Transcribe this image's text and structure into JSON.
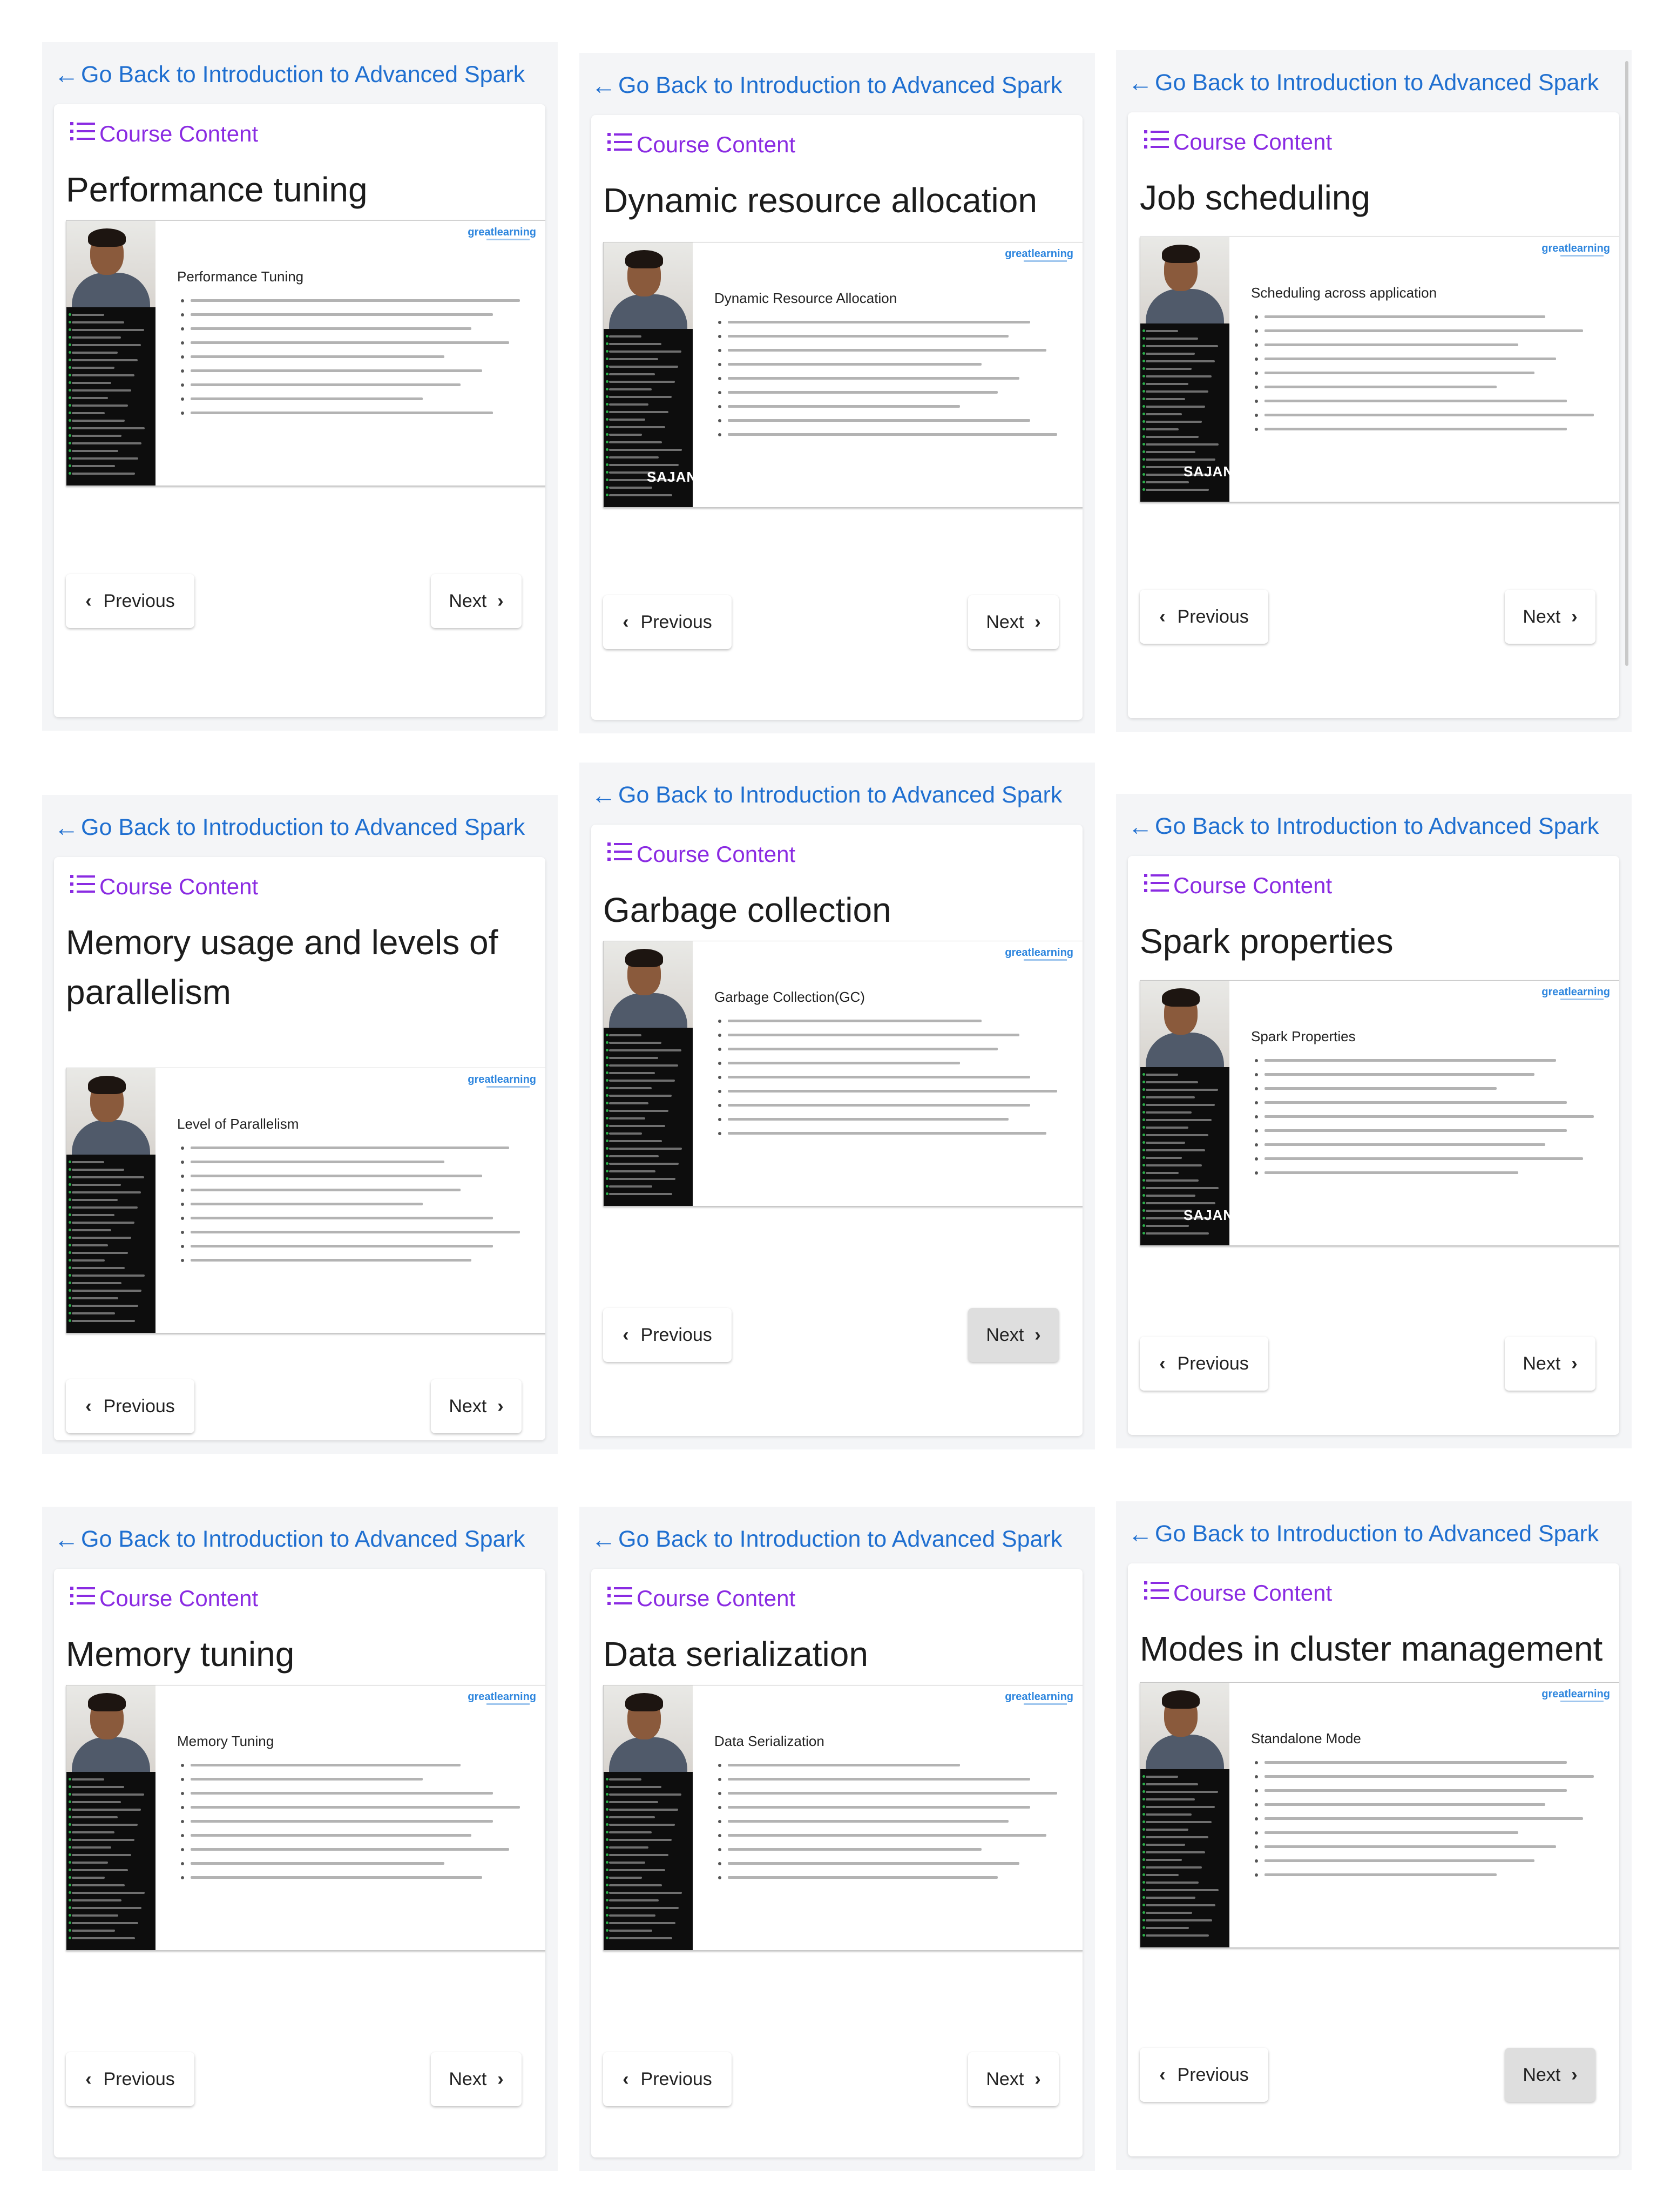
{
  "back_label": "Go Back to Introduction to Advanced Spark",
  "course_content_label": "Course Content",
  "previous_label": "Previous",
  "next_label": "Next",
  "panels": [
    {
      "title": "Performance tuning",
      "slide_title": "Performance Tuning",
      "presenter": "",
      "active_next": false
    },
    {
      "title": "Dynamic resource allocation",
      "slide_title": "Dynamic Resource Allocation",
      "presenter": "SAJAN KEDIA",
      "active_next": false
    },
    {
      "title": "Job scheduling",
      "slide_title": "Scheduling across application",
      "presenter": "SAJAN KEDIA",
      "active_next": false
    },
    {
      "title": "Memory usage and levels of parallelism",
      "slide_title": "Level of Parallelism",
      "presenter": "",
      "active_next": false
    },
    {
      "title": "Garbage collection",
      "slide_title": "Garbage Collection(GC)",
      "presenter": "",
      "active_next": true
    },
    {
      "title": "Spark properties",
      "slide_title": "Spark Properties",
      "presenter": "SAJAN KEDIA",
      "active_next": false
    },
    {
      "title": "Memory tuning",
      "slide_title": "Memory Tuning",
      "presenter": "",
      "active_next": false
    },
    {
      "title": "Data serialization",
      "slide_title": "Data Serialization",
      "presenter": "",
      "active_next": false
    },
    {
      "title": "Modes in cluster management",
      "slide_title": "Standalone Mode",
      "presenter": "",
      "active_next": true
    }
  ],
  "brand": "greatlearning",
  "colors": {
    "link": "#1f6fd0",
    "course_content": "#8a2be2",
    "brand": "#2e86de"
  },
  "icons": {
    "back": "arrow-left-icon",
    "list": "list-icon",
    "prev": "chevron-left-icon",
    "next": "chevron-right-icon"
  }
}
